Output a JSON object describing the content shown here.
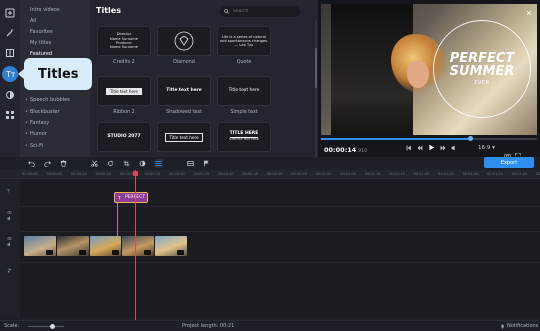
{
  "sidebar": {
    "rail_icons": [
      "import-icon",
      "wand-icon",
      "filters-icon",
      "titles-icon",
      "transitions-icon",
      "more-tools-icon"
    ],
    "categories": [
      {
        "label": "Intro videos",
        "bullet": false
      },
      {
        "label": "All",
        "bullet": false
      },
      {
        "label": "Favorites",
        "bullet": false
      },
      {
        "label": "My titles",
        "bullet": false
      },
      {
        "label": "Featured",
        "bullet": false
      },
      {
        "label": "Speech bubbles",
        "bullet": true
      },
      {
        "label": "Blockbuster",
        "bullet": true
      },
      {
        "label": "Fantasy",
        "bullet": true
      },
      {
        "label": "Humor",
        "bullet": true
      },
      {
        "label": "Sci-Fi",
        "bullet": true
      }
    ]
  },
  "tooltip": {
    "label": "Titles"
  },
  "gallery": {
    "title": "Titles",
    "search_placeholder": "Search",
    "tiles": [
      {
        "label": "Credits 2",
        "line1": "Director",
        "line2": "Name Surname",
        "line3": "Producer",
        "line4": "Name Surname"
      },
      {
        "label": "Diamond",
        "line1": "",
        "line2": "",
        "line3": "",
        "line4": ""
      },
      {
        "label": "Quote",
        "line1": "Life is a series of natural",
        "line2": "and spontaneous changes.",
        "line3": "— Lao Tzu",
        "line4": ""
      },
      {
        "label": "Ribbon 2",
        "line1": "Title text here",
        "line2": "",
        "line3": "",
        "line4": ""
      },
      {
        "label": "Shadowed text",
        "line1": "Title text here",
        "line2": "",
        "line3": "",
        "line4": ""
      },
      {
        "label": "Simple text",
        "line1": "Title text here",
        "line2": "",
        "line3": "",
        "line4": ""
      },
      {
        "label": "",
        "line1": "STUDIO 2077",
        "line2": "",
        "line3": "",
        "line4": ""
      },
      {
        "label": "",
        "line1": "Title text here",
        "line2": "",
        "line3": "",
        "line4": ""
      },
      {
        "label": "",
        "line1": "TITLE HERE",
        "line2": "SUBTITLE TEXT HERE",
        "line3": "",
        "line4": ""
      }
    ]
  },
  "preview": {
    "overlay_line1": "PERFECT",
    "overlay_line2": "SUMMER",
    "overlay_line3": "EVER",
    "timecode": "00:00:14",
    "timecode_ms": ".910",
    "aspect": "16:9",
    "progress": 0.69
  },
  "toolbar": {
    "export_label": "Export"
  },
  "ruler": {
    "ticks": [
      "00:00:00",
      "00:00:05",
      "00:00:10",
      "00:00:15",
      "00:00:20",
      "00:00:25",
      "00:00:30",
      "00:00:35",
      "00:00:40",
      "00:00:45",
      "00:00:50",
      "00:00:55",
      "00:01:00",
      "00:01:05",
      "00:01:10",
      "00:01:15",
      "00:01:20",
      "00:01:25",
      "00:01:30",
      "00:01:35",
      "00:01:40",
      "00:01:45"
    ]
  },
  "timeline": {
    "title_clip_label": "PERFECT"
  },
  "status": {
    "scale_label": "Scale:",
    "project_length": "Project length: 00:21",
    "notifications": "Notifications"
  },
  "colors": {
    "accent": "#2f8ff0",
    "playhead": "#e0455b",
    "title_clip": "#8c3b9a"
  }
}
